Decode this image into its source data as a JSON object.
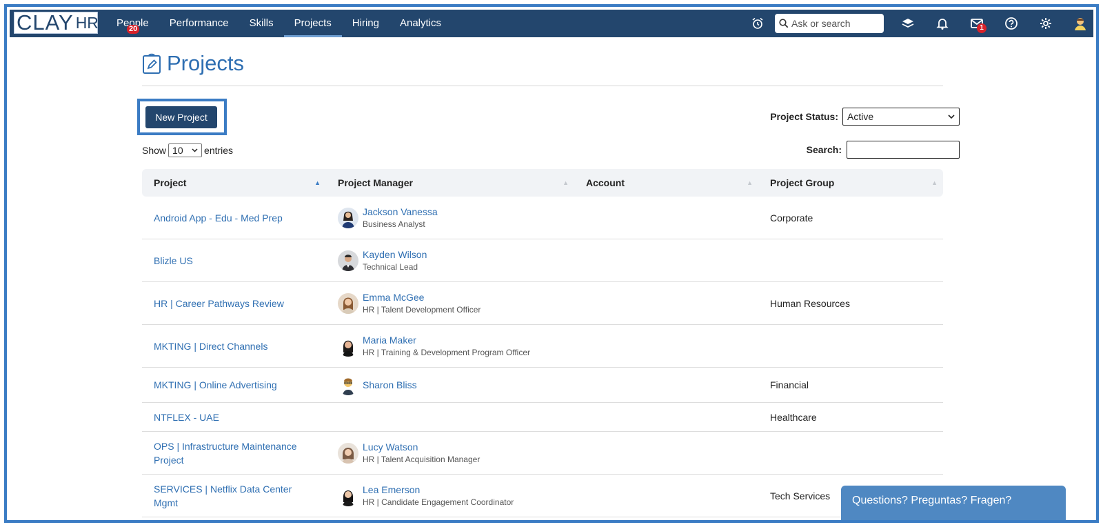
{
  "brand": {
    "logo_main": "CLAY",
    "logo_sub": "HR"
  },
  "nav": {
    "items": [
      {
        "label": "People",
        "badge": "20"
      },
      {
        "label": "Performance"
      },
      {
        "label": "Skills"
      },
      {
        "label": "Projects",
        "active": true
      },
      {
        "label": "Hiring"
      },
      {
        "label": "Analytics"
      }
    ],
    "search_placeholder": "Ask or search",
    "mail_badge": "1"
  },
  "page": {
    "title": "Projects",
    "new_project_label": "New Project",
    "status_label": "Project Status:",
    "status_value": "Active",
    "show_label": "Show",
    "entries_value": "10",
    "entries_label": "entries",
    "search_label": "Search:"
  },
  "table": {
    "headers": [
      "Project",
      "Project Manager",
      "Account",
      "Project Group"
    ],
    "rows": [
      {
        "project": "Android App - Edu - Med Prep",
        "manager": "Jackson Vanessa",
        "manager_title": "Business Analyst",
        "account": "",
        "group": "Corporate"
      },
      {
        "project": "Blizle US",
        "manager": "Kayden Wilson",
        "manager_title": "Technical Lead",
        "account": "",
        "group": ""
      },
      {
        "project": "HR | Career Pathways Review",
        "manager": "Emma McGee",
        "manager_title": "HR | Talent Development Officer",
        "account": "",
        "group": "Human Resources"
      },
      {
        "project": "MKTING | Direct Channels",
        "manager": "Maria Maker",
        "manager_title": "HR | Training & Development Program Officer",
        "account": "",
        "group": ""
      },
      {
        "project": "MKTING | Online Advertising",
        "manager": "Sharon Bliss",
        "manager_title": "",
        "account": "",
        "group": "Financial"
      },
      {
        "project": "NTFLEX - UAE",
        "manager": "",
        "manager_title": "",
        "account": "",
        "group": "Healthcare"
      },
      {
        "project": "OPS | Infrastructure Maintenance Project",
        "manager": "Lucy Watson",
        "manager_title": "HR | Talent Acquisition Manager",
        "account": "",
        "group": ""
      },
      {
        "project": "SERVICES | Netflix Data Center Mgmt",
        "manager": "Lea Emerson",
        "manager_title": "HR | Candidate Engagement Coordinator",
        "account": "",
        "group": "Tech Services"
      }
    ]
  },
  "chat": {
    "label": "Questions? Preguntas? Fragen?"
  },
  "colors": {
    "nav_bg": "#23466d",
    "accent": "#2f6fb2",
    "highlight": "#3b7cc4",
    "badge": "#d8222a",
    "chat": "#4f88c2"
  }
}
